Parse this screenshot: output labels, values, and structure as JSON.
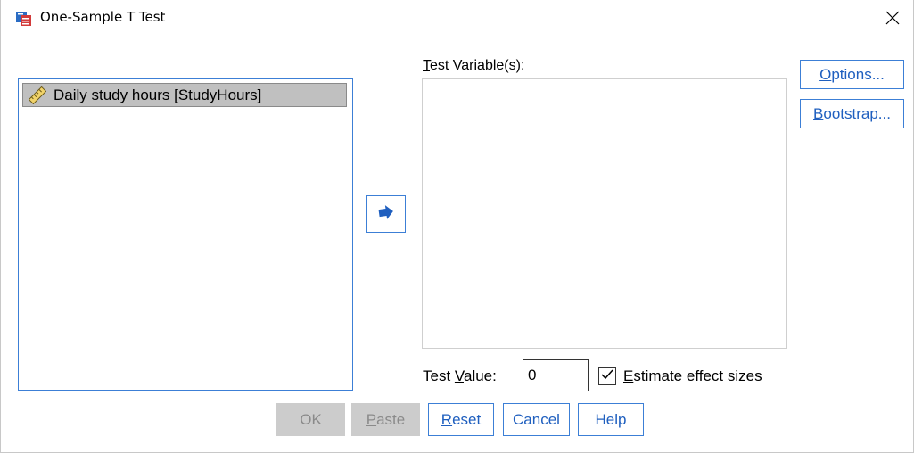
{
  "window": {
    "title": "One-Sample T Test"
  },
  "icons": {
    "app": "spss-dialog-icon",
    "close": "close-icon",
    "variable": "scale-ruler-icon",
    "move": "arrow-right-icon",
    "check": "checkmark-icon"
  },
  "source_list": {
    "items": [
      {
        "label": "Daily study hours [StudyHours]",
        "selected": true
      }
    ]
  },
  "test_variables": {
    "label_mnemonic": "T",
    "label_rest": "est Variable(s):",
    "items": []
  },
  "side_buttons": {
    "options": {
      "mnemonic": "O",
      "rest": "ptions..."
    },
    "bootstrap": {
      "mnemonic": "B",
      "rest": "ootstrap..."
    }
  },
  "test_value": {
    "label_pre": "Test ",
    "label_mnemonic": "V",
    "label_post": "alue:",
    "value": "0"
  },
  "effect_sizes": {
    "checked": true,
    "mnemonic": "E",
    "rest": "stimate effect sizes"
  },
  "bottom_buttons": {
    "ok": {
      "label": "OK",
      "enabled": false
    },
    "paste": {
      "mnemonic": "P",
      "rest": "aste",
      "enabled": false
    },
    "reset": {
      "mnemonic": "R",
      "rest": "eset",
      "enabled": true
    },
    "cancel": {
      "label": "Cancel",
      "enabled": true
    },
    "help": {
      "label": "Help",
      "enabled": true
    }
  },
  "colors": {
    "accent_border": "#3c7fd6",
    "accent_text": "#1f5fbf",
    "disabled_bg": "#cccccc",
    "selected_item_bg": "#c0c0c0"
  }
}
